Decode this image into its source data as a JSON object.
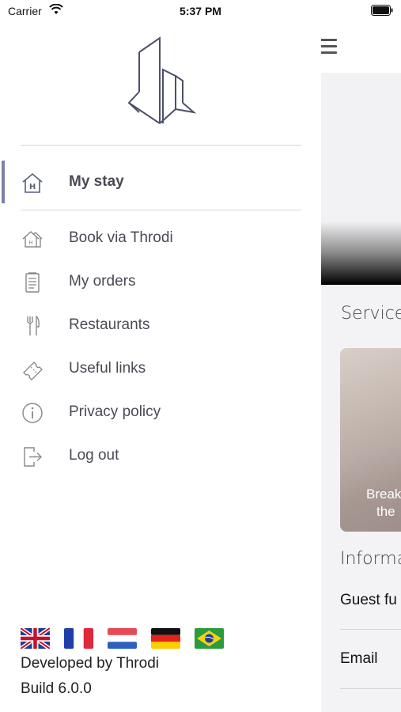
{
  "status_bar": {
    "carrier": "Carrier",
    "time": "5:37 PM"
  },
  "drawer": {
    "active_item": {
      "label": "My stay",
      "icon": "hotel-house-icon"
    },
    "items": [
      {
        "label": "Book via Throdi",
        "icon": "house-icon"
      },
      {
        "label": "My orders",
        "icon": "receipt-icon"
      },
      {
        "label": "Restaurants",
        "icon": "fork-knife-icon"
      },
      {
        "label": "Useful links",
        "icon": "ticket-icon"
      },
      {
        "label": "Privacy policy",
        "icon": "info-icon"
      },
      {
        "label": "Log out",
        "icon": "logout-icon"
      }
    ],
    "languages": [
      "English",
      "French",
      "Dutch",
      "German",
      "Portuguese"
    ],
    "developed_by": "Developed by Throdi",
    "build": "Build 6.0.0"
  },
  "main": {
    "services_title": "Services",
    "card_text_line1": "Break",
    "card_text_line2": "the",
    "information_title": "Informa",
    "rows": [
      "Guest fu",
      "Email"
    ]
  },
  "colors": {
    "accent": "#7c82a3",
    "text": "#4a4a55",
    "divider": "#d8d8d8"
  }
}
